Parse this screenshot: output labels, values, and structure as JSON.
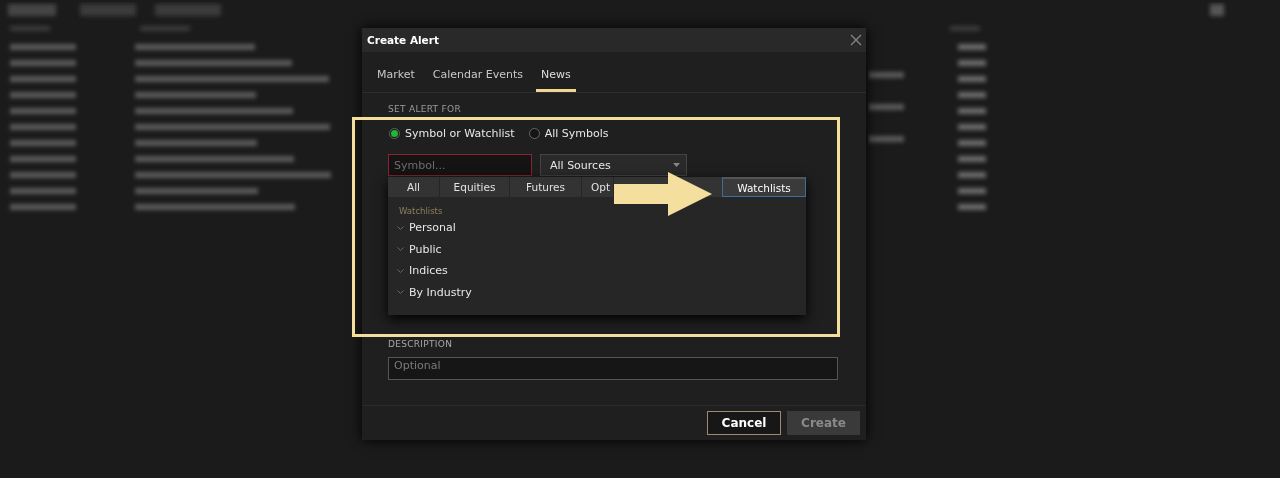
{
  "dialog": {
    "title": "Create Alert",
    "tabs": [
      {
        "label": "Market",
        "selected": false
      },
      {
        "label": "Calendar Events",
        "selected": false
      },
      {
        "label": "News",
        "selected": true
      }
    ],
    "section_label": "SET ALERT FOR",
    "scope_options": [
      {
        "label": "Symbol or Watchlist",
        "selected": true
      },
      {
        "label": "All Symbols",
        "selected": false
      }
    ],
    "symbol_field": {
      "placeholder": "Symbol..."
    },
    "sources_select": {
      "value": "All Sources"
    },
    "symbol_dropdown": {
      "tabs": [
        {
          "label": "All",
          "selected": false
        },
        {
          "label": "Equities",
          "selected": false
        },
        {
          "label": "Futures",
          "selected": false
        },
        {
          "label": "Opt",
          "selected": false
        },
        {
          "label": "Watchlists",
          "selected": true
        }
      ],
      "group_heading": "Watchlists",
      "groups": [
        {
          "label": "Personal"
        },
        {
          "label": "Public"
        },
        {
          "label": "Indices"
        },
        {
          "label": "By Industry"
        }
      ]
    },
    "description_label": "DESCRIPTION",
    "description_field": {
      "placeholder": "Optional"
    },
    "buttons": [
      {
        "label": "Cancel",
        "disabled": false
      },
      {
        "label": "Create",
        "disabled": true
      }
    ]
  }
}
